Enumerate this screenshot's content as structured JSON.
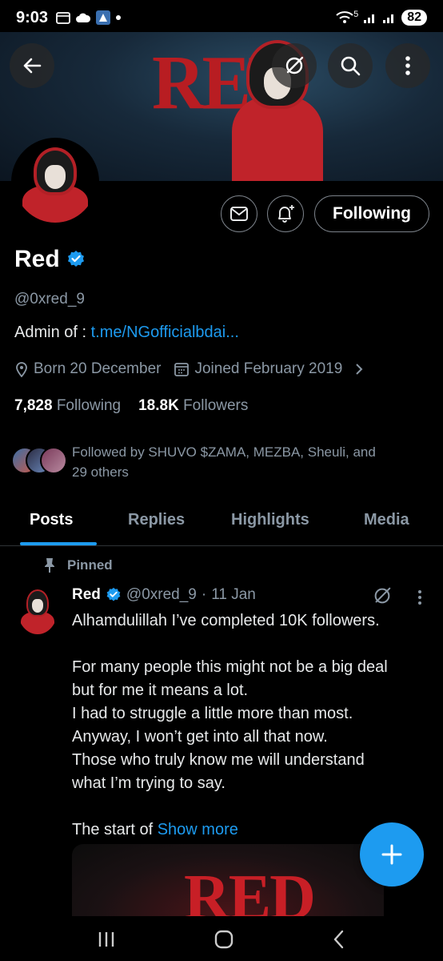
{
  "status_bar": {
    "time": "9:03",
    "battery": "82",
    "network_badge": "5"
  },
  "banner": {
    "word": "RED"
  },
  "profile": {
    "name": "Red",
    "handle": "@0xred_9",
    "bio_prefix": "Admin of : ",
    "bio_link": "t.me/NGofficialbdai...",
    "born": "Born 20 December",
    "joined": "Joined February 2019",
    "following_count": "7,828",
    "following_label": "Following",
    "followers_count": "18.8K",
    "followers_label": "Followers",
    "followed_by_line1": "Followed by SHUVO $ZAMA, MEZBA, Sheuli, and",
    "followed_by_line2": "29 others",
    "follow_button_label": "Following"
  },
  "tabs": [
    "Posts",
    "Replies",
    "Highlights",
    "Media"
  ],
  "pinned_post": {
    "pinned_label": "Pinned",
    "author_name": "Red",
    "author_handle": "@0xred_9",
    "date": "11 Jan",
    "separator": "·",
    "lines": [
      "Alhamdulillah I’ve completed 10K followers.",
      "",
      "For many people this might not be a big deal",
      "but for me it means a lot.",
      "I had to struggle a little more than most.",
      "Anyway, I won’t get into all that now.",
      "Those who truly know me will understand",
      "what I’m trying to say.",
      ""
    ],
    "last_line_prefix": "The start of ",
    "show_more": "Show more",
    "media_word": "RED"
  },
  "colors": {
    "accent": "#1d9bf0",
    "background": "#000000",
    "secondary_text": "#8b98a5",
    "brand_red": "#c0232a"
  },
  "icons": {
    "back": "arrow-left-icon",
    "grok": "grok-icon",
    "search": "search-icon",
    "more": "more-vertical-icon",
    "message": "envelope-icon",
    "notify": "bell-plus-icon",
    "verified": "verified-badge-icon",
    "location": "location-icon",
    "calendar": "calendar-icon",
    "chevron": "chevron-right-icon",
    "pin": "pin-icon",
    "compose": "plus-icon"
  }
}
